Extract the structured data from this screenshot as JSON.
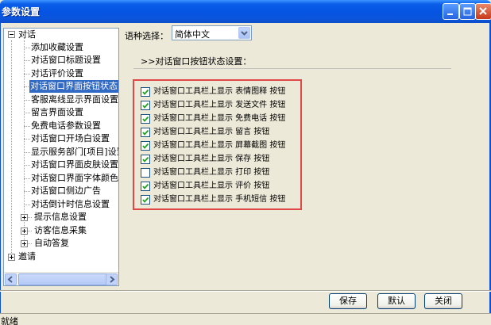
{
  "window": {
    "title": "参数设置"
  },
  "tree": {
    "items": [
      {
        "label": "对话",
        "level": 0,
        "expander": "minus"
      },
      {
        "label": "添加收藏设置",
        "level": 1
      },
      {
        "label": "对话窗口标题设置",
        "level": 1
      },
      {
        "label": "对话评价设置",
        "level": 1
      },
      {
        "label": "对话窗口界面按钮状态",
        "level": 1,
        "selected": true
      },
      {
        "label": "客服离线显示界面设置",
        "level": 1
      },
      {
        "label": "留言界面设置",
        "level": 1
      },
      {
        "label": "免费电话参数设置",
        "level": 1
      },
      {
        "label": "对话窗口开场白设置",
        "level": 1
      },
      {
        "label": "显示服务部门[项目]设置",
        "level": 1
      },
      {
        "label": "对话窗口界面皮肤设置",
        "level": 1
      },
      {
        "label": "对话窗口界面字体颜色",
        "level": 1
      },
      {
        "label": "对话窗口侧边广告",
        "level": 1
      },
      {
        "label": "对话倒计时信息设置",
        "level": 1
      },
      {
        "label": "提示信息设置",
        "level": 1,
        "expander": "plus"
      },
      {
        "label": "访客信息采集",
        "level": 1,
        "expander": "plus"
      },
      {
        "label": "自动答复",
        "level": 1,
        "expander": "plus"
      },
      {
        "label": "邀请",
        "level": 0,
        "expander": "plus"
      }
    ]
  },
  "language": {
    "label": "语种选择：",
    "selected": "简体中文"
  },
  "section": {
    "title": ">>对话窗口按钮状态设置："
  },
  "checkboxes": [
    {
      "label": "对话窗口工具栏上显示 表情图释 按钮",
      "checked": true
    },
    {
      "label": "对话窗口工具栏上显示 发送文件 按钮",
      "checked": true
    },
    {
      "label": "对话窗口工具栏上显示 免费电话 按钮",
      "checked": true
    },
    {
      "label": "对话窗口工具栏上显示 留言 按钮",
      "checked": true
    },
    {
      "label": "对话窗口工具栏上显示 屏幕截图 按钮",
      "checked": true
    },
    {
      "label": "对话窗口工具栏上显示 保存 按钮",
      "checked": true
    },
    {
      "label": "对话窗口工具栏上显示 打印 按钮",
      "checked": false
    },
    {
      "label": "对话窗口工具栏上显示 评价 按钮",
      "checked": true
    },
    {
      "label": "对话窗口工具栏上显示 手机短信 按钮",
      "checked": true
    }
  ],
  "buttons": {
    "save": "保存",
    "default": "默认",
    "close": "关闭"
  },
  "status": {
    "text": "就绪"
  },
  "colors": {
    "titlebar": "#0554e3",
    "selection": "#316ac5",
    "group_border": "#e04848"
  }
}
